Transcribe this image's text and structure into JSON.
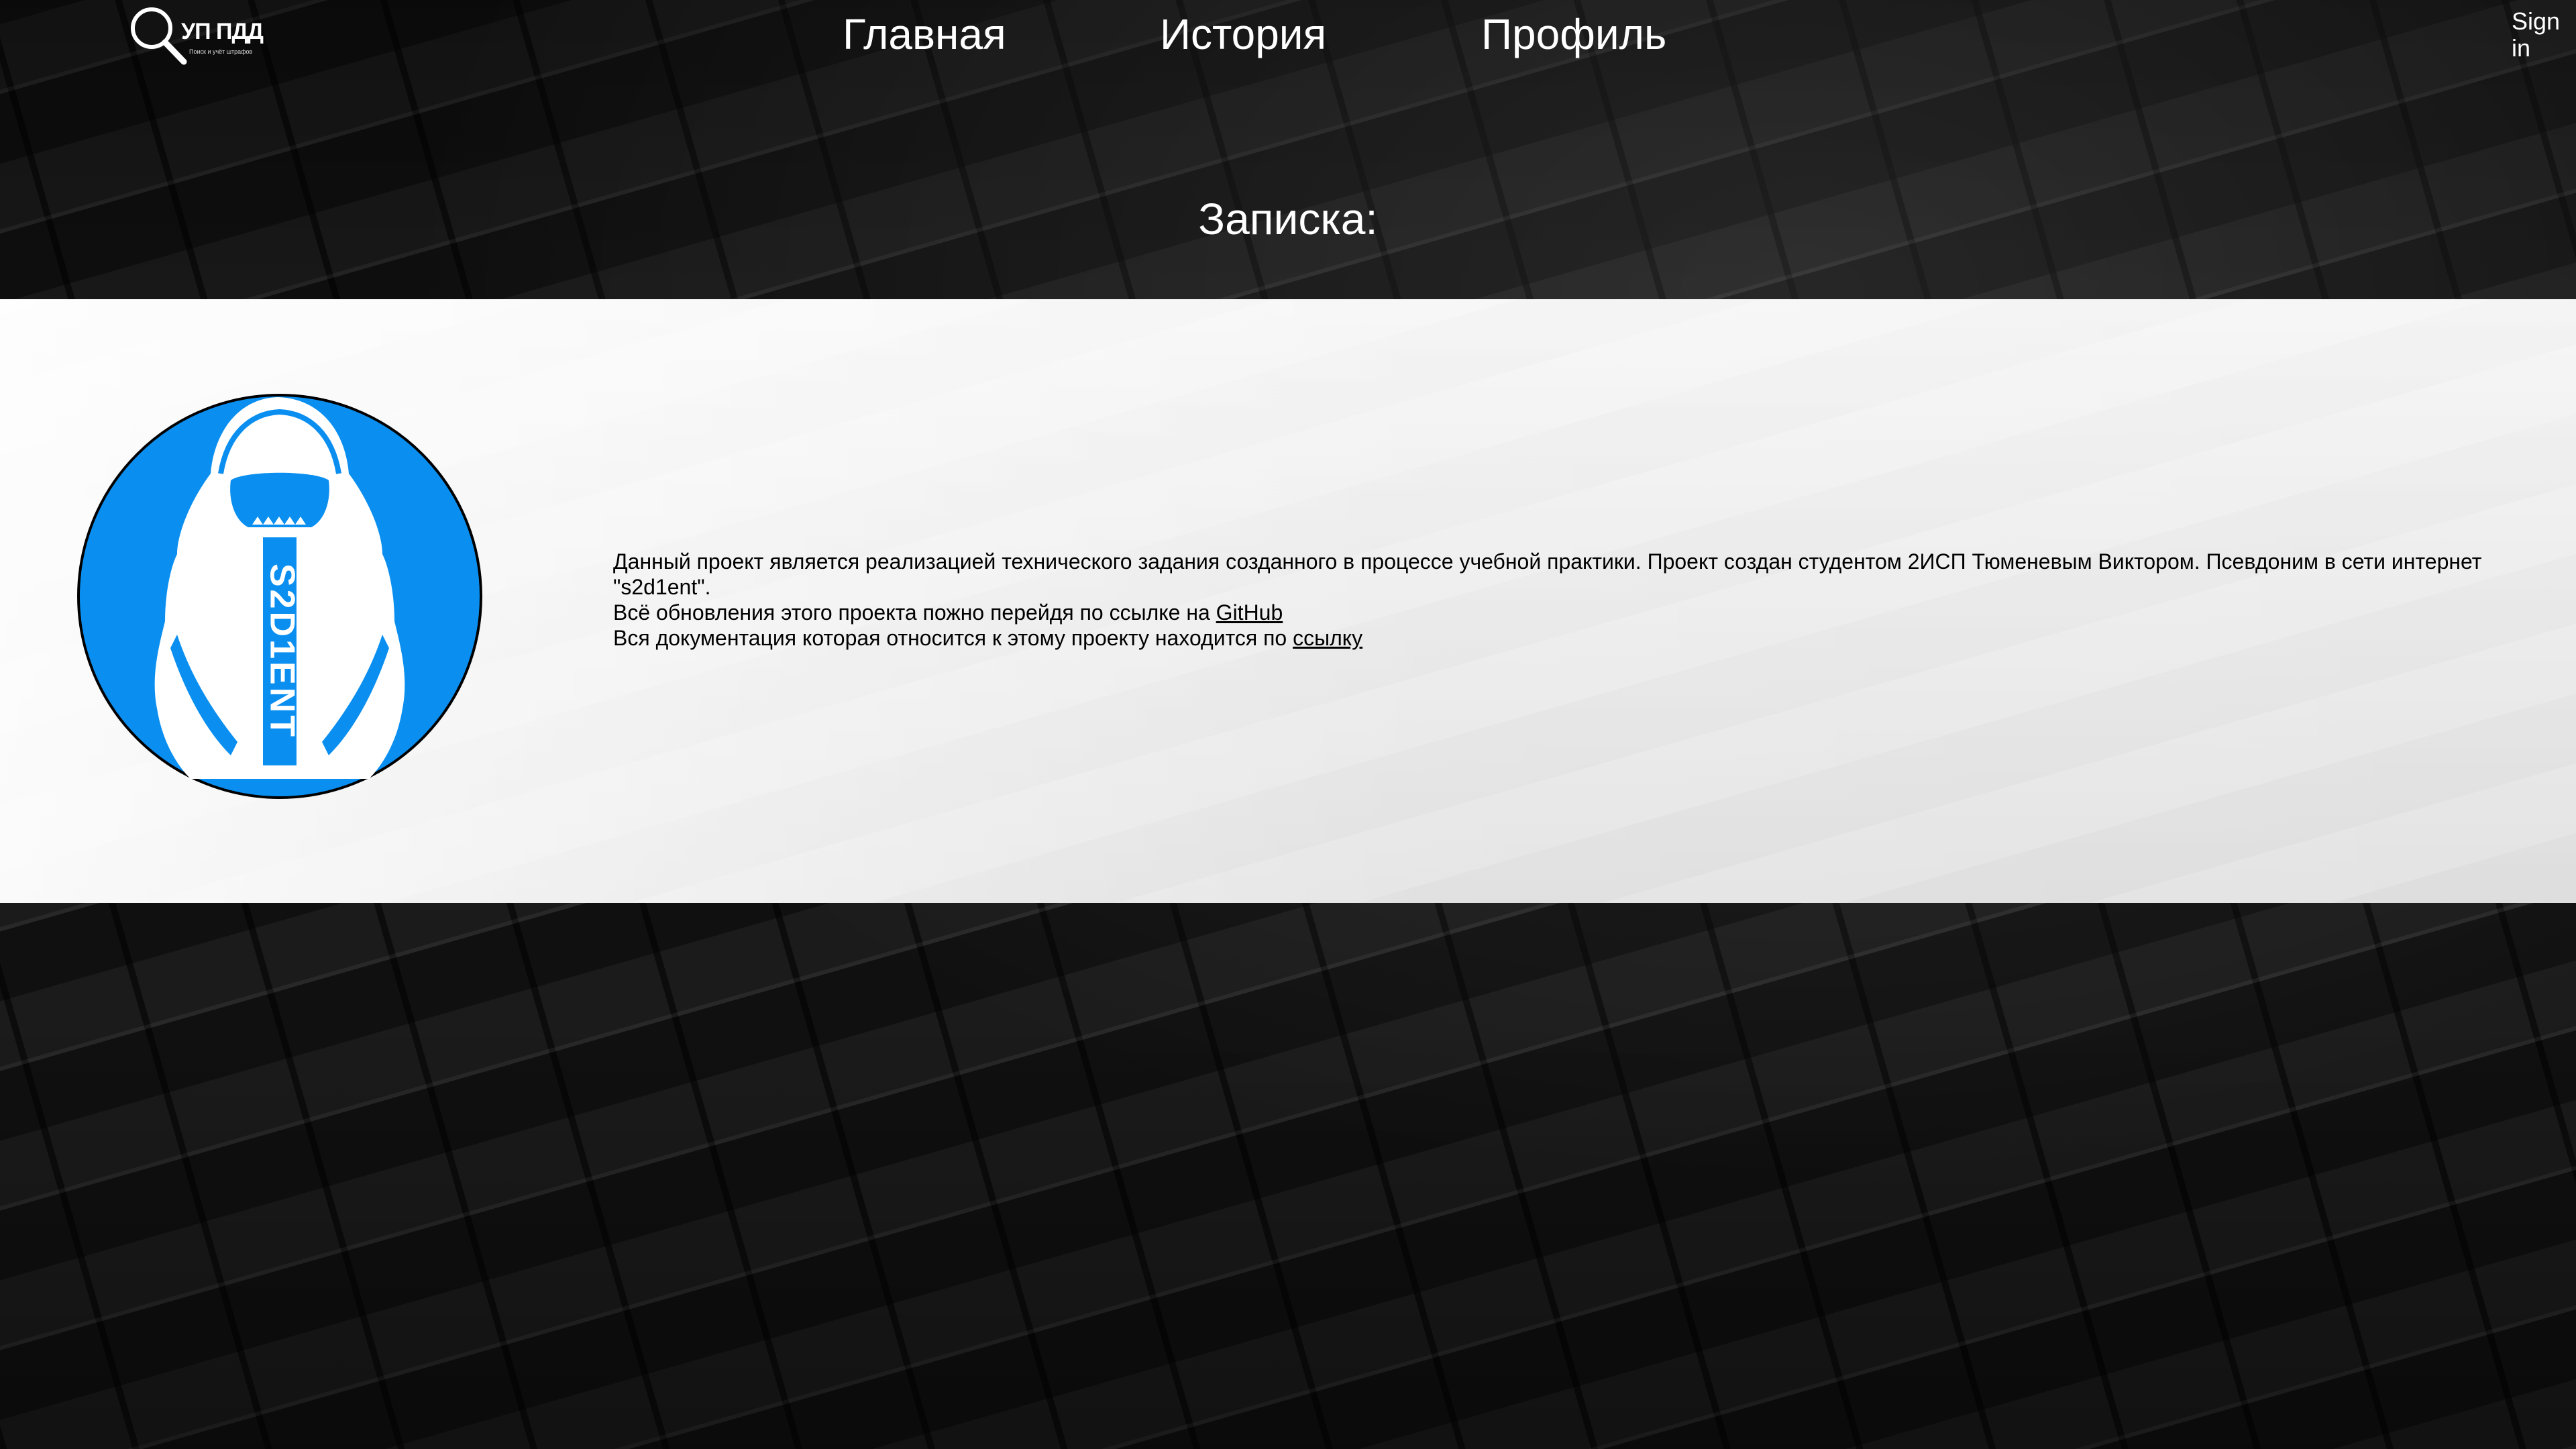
{
  "header": {
    "logo": {
      "title": "УП ПДД",
      "subtitle": "Поиск и учёт штрафов"
    },
    "nav": [
      {
        "label": "Главная"
      },
      {
        "label": "История"
      },
      {
        "label": "Профиль"
      }
    ],
    "signin_label": "Sign in"
  },
  "page": {
    "title": "Записка:"
  },
  "about": {
    "avatar_text": "S2D1ENT",
    "avatar_color": "#0a8ff0",
    "paragraph1": "Данный проект является реализацией технического задания созданного в процессе учебной практики. Проект создан студентом 2ИСП Тюменевым Виктором. Псевдоним в сети интернет \"s2d1ent\".",
    "paragraph2_prefix": "Всё обновления этого проекта пожно перейдя по ссылке на ",
    "github_link": "GitHub",
    "paragraph3_prefix": "Вся документация которая относится к этому проекту находится по ",
    "docs_link": "ссылку"
  },
  "icons": {
    "logo": "magnifier-icon"
  }
}
